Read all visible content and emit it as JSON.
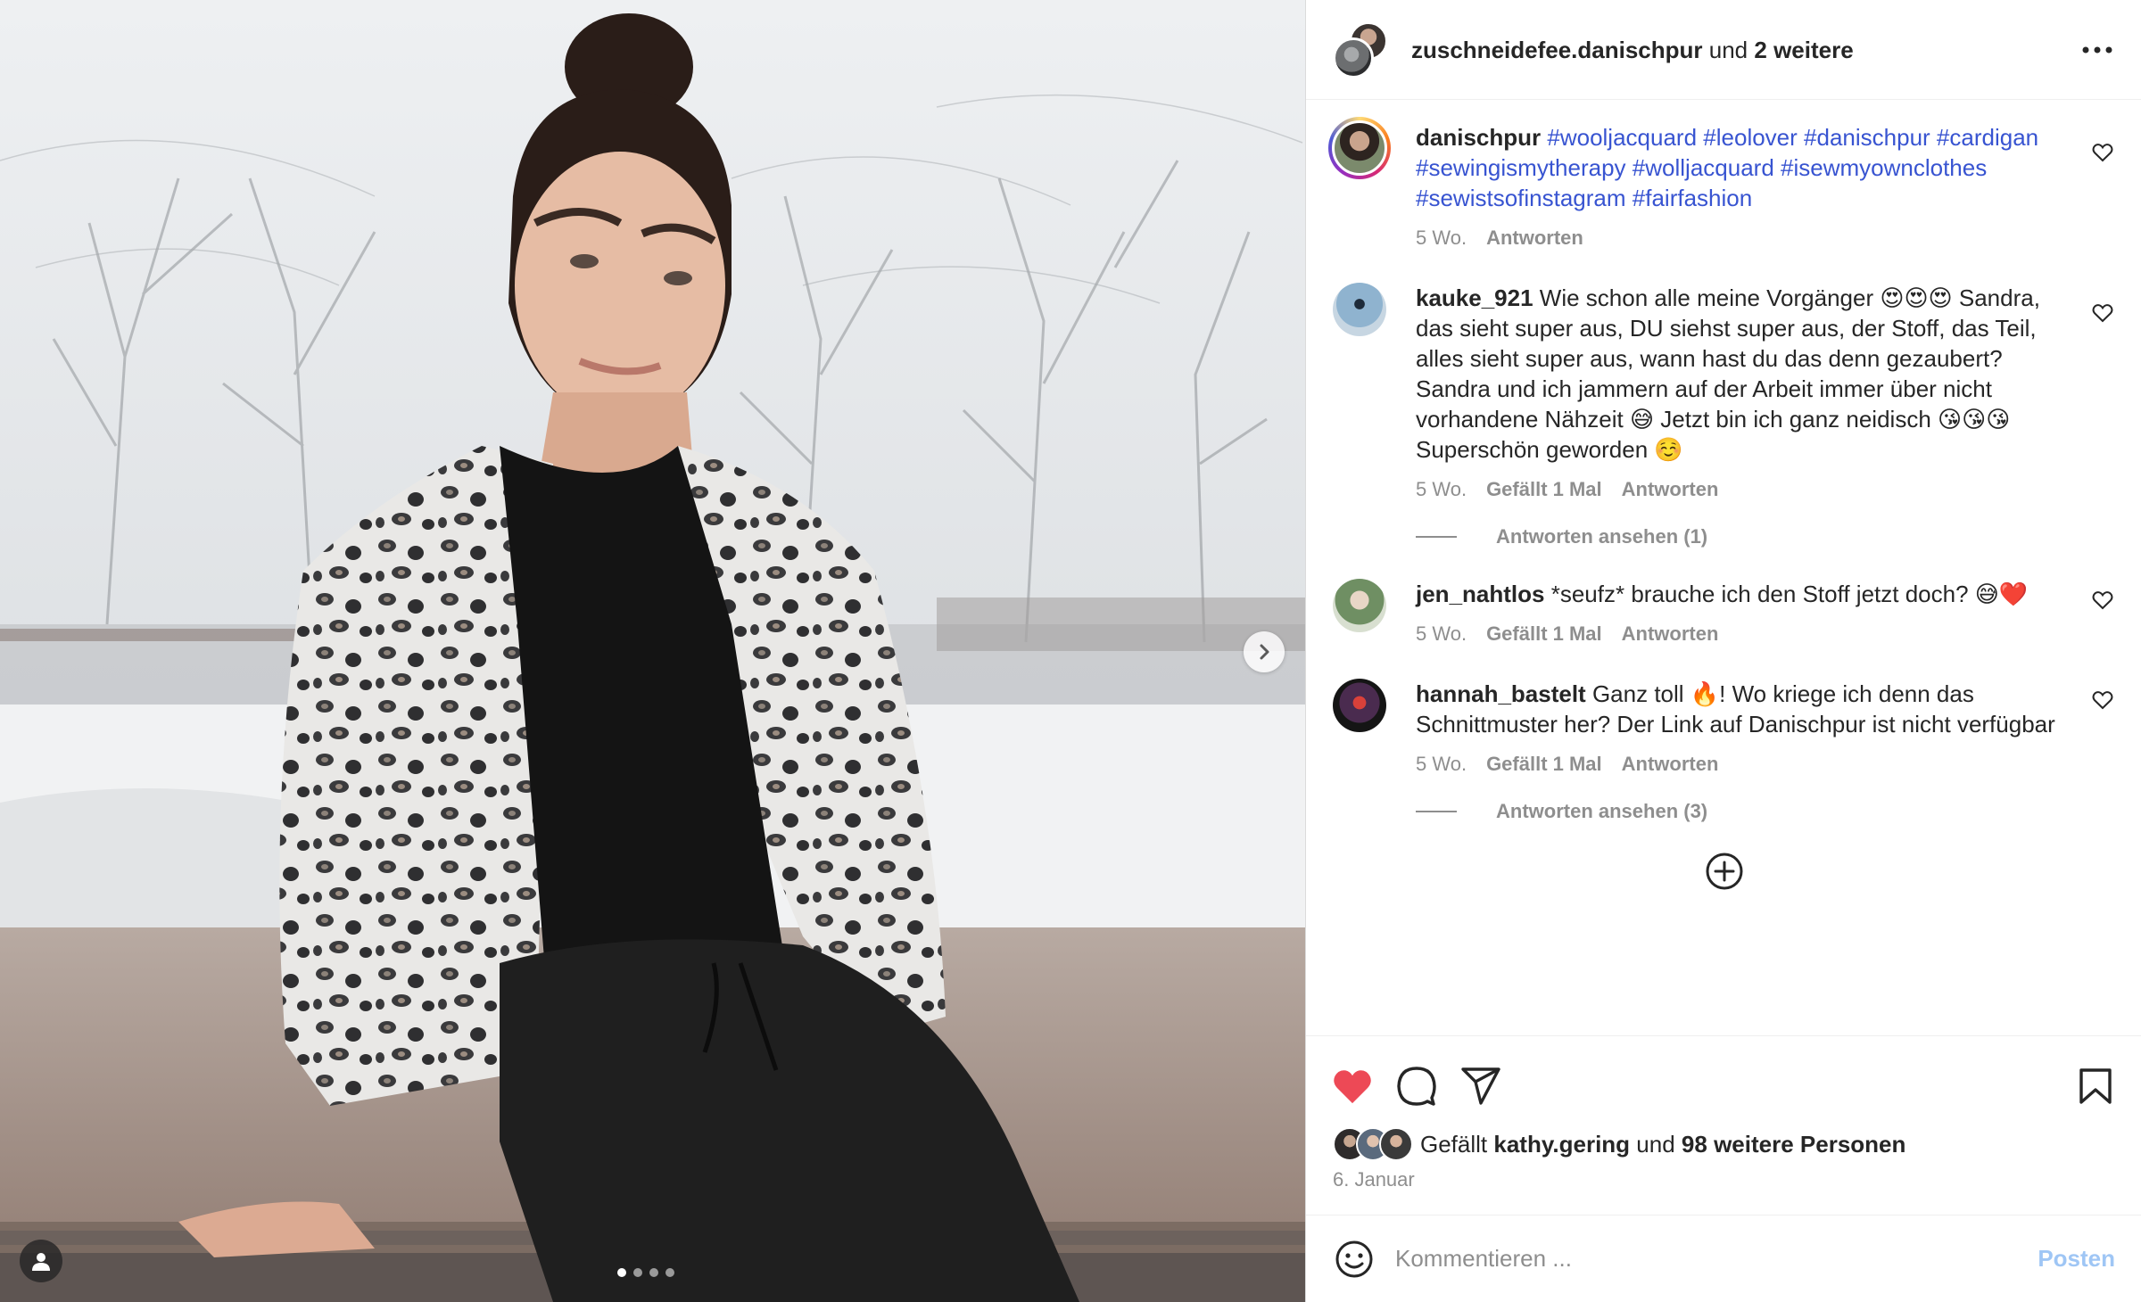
{
  "header": {
    "username": "zuschneidefee.danischpur",
    "and_text": "und",
    "others": "2 weitere",
    "more_icon": "more-horizontal-icon"
  },
  "carousel": {
    "slide_count": 4,
    "active_index": 0
  },
  "comments": [
    {
      "username": "danischpur",
      "text_parts": [
        "#wooljacquard",
        " ",
        "#leolover",
        " ",
        "#danischpur",
        " ",
        "#cardigan",
        " ",
        "#sewingismytherapy",
        " ",
        "#wolljacquard",
        " ",
        "#isewmyownclothes",
        " ",
        "#sewistsofinstagram",
        " ",
        "#fairfashion"
      ],
      "time": "5 Wo.",
      "likes": "",
      "reply": "Antworten"
    },
    {
      "username": "kauke_921",
      "text": "Wie schon alle meine Vorgänger 😍😍😍 Sandra, das sieht super aus, DU siehst super aus, der Stoff, das Teil, alles sieht super aus, wann hast du das denn gezaubert? Sandra und ich jammern auf der Arbeit immer über nicht vorhandene Nähzeit 😅 Jetzt bin ich ganz neidisch 😘😘😘 Superschön geworden ☺️",
      "time": "5 Wo.",
      "likes": "Gefällt 1 Mal",
      "reply": "Antworten",
      "view_replies": "Antworten ansehen (1)"
    },
    {
      "username": "jen_nahtlos",
      "text": "*seufz* brauche ich den Stoff jetzt doch? 😅❤️",
      "time": "5 Wo.",
      "likes": "Gefällt 1 Mal",
      "reply": "Antworten"
    },
    {
      "username": "hannah_bastelt",
      "text": "Ganz toll 🔥! Wo kriege ich denn das Schnittmuster her? Der Link auf Danischpur ist nicht verfügbar",
      "time": "5 Wo.",
      "likes": "Gefällt 1 Mal",
      "reply": "Antworten",
      "view_replies": "Antworten ansehen (3)"
    }
  ],
  "actions": {
    "like_icon": "heart-filled-icon",
    "comment_icon": "comment-icon",
    "share_icon": "share-icon",
    "save_icon": "bookmark-icon",
    "liked": true,
    "like_color": "#ed4956"
  },
  "likes": {
    "prefix": "Gefällt",
    "user": "kathy.gering",
    "middle": "und",
    "count_text": "98 weitere Personen"
  },
  "date": "6. Januar",
  "comment_box": {
    "placeholder": "Kommentieren ...",
    "post_label": "Posten"
  },
  "colors": {
    "hashtag": "#3854d1",
    "muted": "#8e8e8e",
    "post_disabled": "#9fc6f5"
  }
}
